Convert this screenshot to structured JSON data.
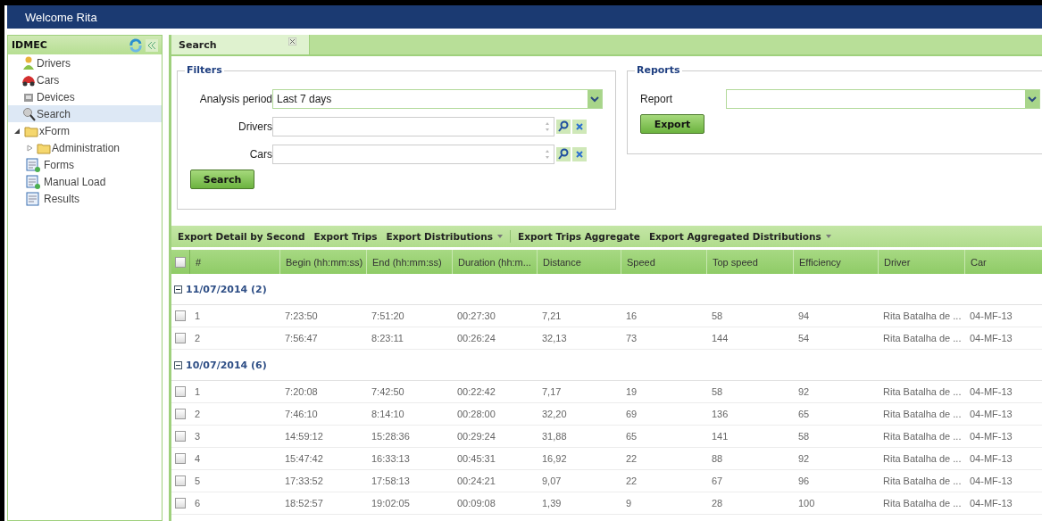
{
  "window": {
    "title": "Welcome Rita"
  },
  "sidebar": {
    "title": "IDMEC",
    "items": [
      {
        "label": "Drivers",
        "kind": "person",
        "selected": false
      },
      {
        "label": "Cars",
        "kind": "car",
        "selected": false
      },
      {
        "label": "Devices",
        "kind": "device",
        "selected": false
      },
      {
        "label": "Search",
        "kind": "search",
        "selected": true
      },
      {
        "label": "xForm",
        "kind": "folder",
        "selected": false,
        "expanded": true,
        "children": [
          {
            "label": "Administration",
            "kind": "folder",
            "selected": false,
            "expanded": false
          },
          {
            "label": "Forms",
            "kind": "formadd",
            "selected": false
          },
          {
            "label": "Manual Load",
            "kind": "formadd",
            "selected": false
          },
          {
            "label": "Results",
            "kind": "form",
            "selected": false
          }
        ]
      }
    ]
  },
  "tabs": [
    {
      "label": "Search",
      "selected": true
    }
  ],
  "filters": {
    "title": "Filters",
    "analysis_period": {
      "label": "Analysis period",
      "value": "Last 7 days"
    },
    "drivers": {
      "label": "Drivers"
    },
    "cars": {
      "label": "Cars"
    },
    "button": "Search"
  },
  "reports": {
    "title": "Reports",
    "report": {
      "label": "Report"
    },
    "button": "Export"
  },
  "toolbar": [
    {
      "label": "Export Detail by Second",
      "dropdown": false
    },
    {
      "label": "Export Trips",
      "dropdown": false
    },
    {
      "label": "Export Distributions",
      "dropdown": true
    },
    {
      "label": "Export Trips Aggregate",
      "dropdown": false
    },
    {
      "label": "Export Aggregated Distributions",
      "dropdown": true
    }
  ],
  "table": {
    "all_checked": false,
    "columns": [
      "#",
      "Begin (hh:mm:ss)",
      "End (hh:mm:ss)",
      "Duration (hh:m...",
      "Distance",
      "Speed",
      "Top speed",
      "Efficiency",
      "Driver",
      "Car"
    ],
    "groups": [
      {
        "title": "11/07/2014 (2)",
        "expanded": true,
        "rows": [
          {
            "checked": false,
            "cells": [
              "1",
              "7:23:50",
              "7:51:20",
              "00:27:30",
              "7,21",
              "16",
              "58",
              "94",
              "Rita Batalha de ...",
              "04-MF-13"
            ]
          },
          {
            "checked": false,
            "cells": [
              "2",
              "7:56:47",
              "8:23:11",
              "00:26:24",
              "32,13",
              "73",
              "144",
              "54",
              "Rita Batalha de ...",
              "04-MF-13"
            ]
          }
        ]
      },
      {
        "title": "10/07/2014 (6)",
        "expanded": true,
        "rows": [
          {
            "checked": false,
            "cells": [
              "1",
              "7:20:08",
              "7:42:50",
              "00:22:42",
              "7,17",
              "19",
              "58",
              "92",
              "Rita Batalha de ...",
              "04-MF-13"
            ]
          },
          {
            "checked": false,
            "cells": [
              "2",
              "7:46:10",
              "8:14:10",
              "00:28:00",
              "32,20",
              "69",
              "136",
              "65",
              "Rita Batalha de ...",
              "04-MF-13"
            ]
          },
          {
            "checked": false,
            "cells": [
              "3",
              "14:59:12",
              "15:28:36",
              "00:29:24",
              "31,88",
              "65",
              "141",
              "58",
              "Rita Batalha de ...",
              "04-MF-13"
            ]
          },
          {
            "checked": false,
            "cells": [
              "4",
              "15:47:42",
              "16:33:13",
              "00:45:31",
              "16,92",
              "22",
              "88",
              "92",
              "Rita Batalha de ...",
              "04-MF-13"
            ]
          },
          {
            "checked": false,
            "cells": [
              "5",
              "17:33:52",
              "17:58:13",
              "00:24:21",
              "9,07",
              "22",
              "67",
              "96",
              "Rita Batalha de ...",
              "04-MF-13"
            ]
          },
          {
            "checked": false,
            "cells": [
              "6",
              "18:52:57",
              "19:02:05",
              "00:09:08",
              "1,39",
              "9",
              "28",
              "100",
              "Rita Batalha de ...",
              "04-MF-13"
            ]
          }
        ]
      }
    ]
  }
}
